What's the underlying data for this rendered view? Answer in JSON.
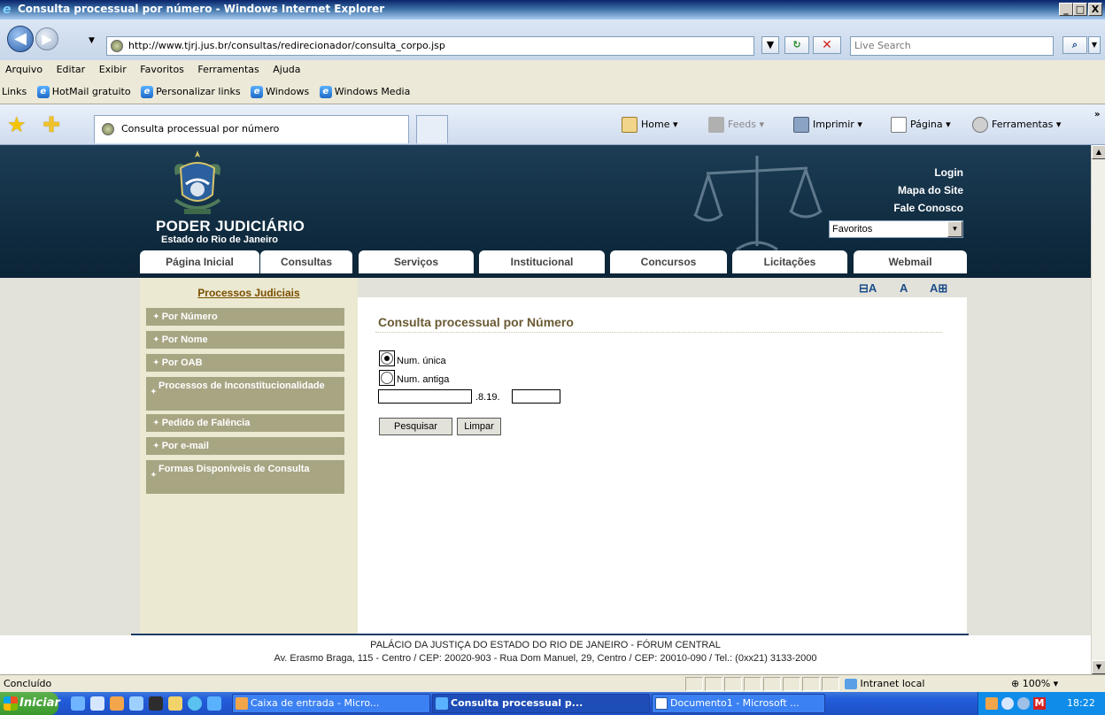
{
  "window": {
    "title": "Consulta processual por número - Windows Internet Explorer",
    "min_label": "_",
    "max_label": "□",
    "close_label": "X"
  },
  "address": {
    "url": "http://www.tjrj.jus.br/consultas/redirecionador/consulta_corpo.jsp",
    "search_placeholder": "Live Search"
  },
  "menu": [
    "Arquivo",
    "Editar",
    "Exibir",
    "Favoritos",
    "Ferramentas",
    "Ajuda"
  ],
  "links": {
    "label": "Links",
    "items": [
      "HotMail gratuito",
      "Personalizar links",
      "Windows",
      "Windows Media"
    ]
  },
  "tab": {
    "title": "Consulta processual por número"
  },
  "commands": {
    "home": "Home",
    "feeds": "Feeds",
    "print": "Imprimir",
    "page": "Página",
    "tools": "Ferramentas"
  },
  "site": {
    "brand_title": "PODER JUDICIÁRIO",
    "brand_sub": "Estado do Rio de Janeiro",
    "top_links": [
      "Login",
      "Mapa do Site",
      "Fale Conosco"
    ],
    "favorites_select": "Favoritos",
    "nav": [
      "Página Inicial",
      "Consultas",
      "Serviços",
      "Institucional",
      "Concursos",
      "Licitações",
      "Webmail"
    ],
    "sidebar_title": "Processos Judiciais",
    "sidebar_items": [
      "Por Número",
      "Por Nome",
      "Por OAB",
      "Processos de Inconstitucionalidade",
      "Pedido de Falência",
      "Por e-mail",
      "Formas Disponíveis de Consulta"
    ],
    "font_controls": [
      "⊟A",
      "A",
      "A⊞"
    ],
    "content_title": "Consulta processual por Número",
    "radio_unica": "Num. única",
    "radio_antiga": "Num. antiga",
    "number_separator": ".8.19.",
    "btn_search": "Pesquisar",
    "btn_clear": "Limpar",
    "footer_line1": "PALÁCIO DA JUSTIÇA DO ESTADO DO RIO DE JANEIRO - FÓRUM CENTRAL",
    "footer_line2": "Av. Erasmo Braga, 115 - Centro / CEP: 20020-903 - Rua Dom Manuel, 29, Centro / CEP: 20010-090 / Tel.: (0xx21) 3133-2000"
  },
  "status": {
    "text": "Concluído",
    "zone": "Intranet local",
    "zoom": "100%"
  },
  "taskbar": {
    "start": "Iniciar",
    "tasks": [
      "Caixa de entrada - Micro...",
      "Consulta processual p...",
      "Documento1 - Microsoft ..."
    ],
    "clock": "18:22"
  }
}
